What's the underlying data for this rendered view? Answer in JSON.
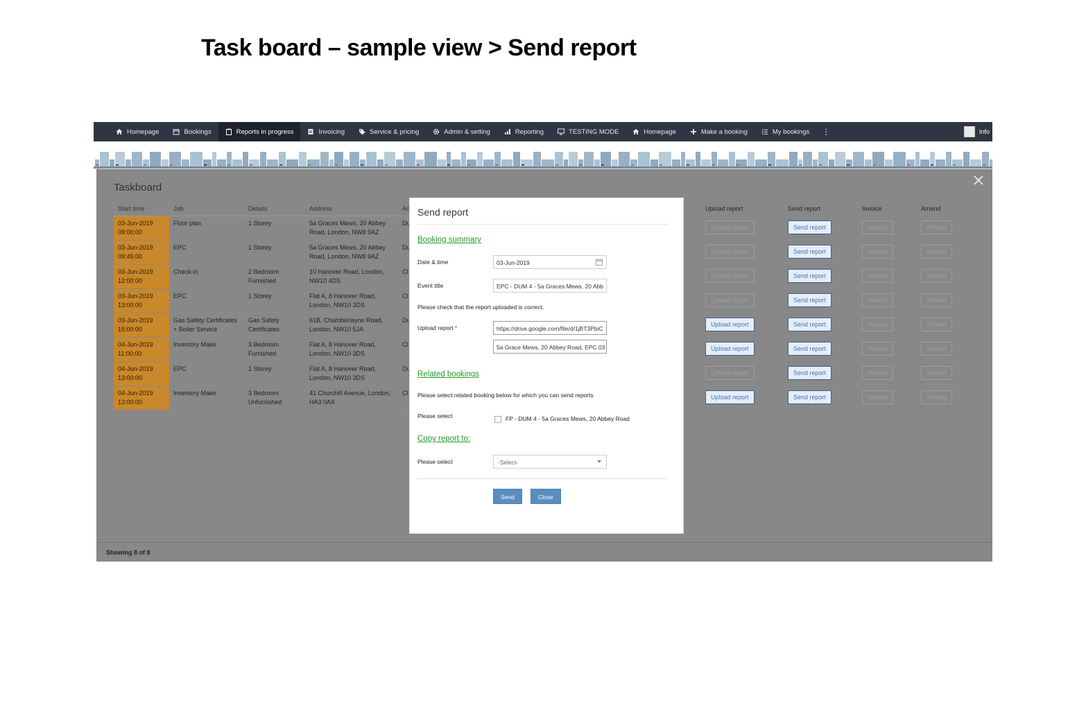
{
  "slide_title": "Task board – sample view > Send report",
  "nav": {
    "items": [
      {
        "label": "Homepage",
        "icon": "home-icon"
      },
      {
        "label": "Bookings",
        "icon": "calendar-icon"
      },
      {
        "label": "Reports in progress",
        "icon": "clipboard-icon"
      },
      {
        "label": "Invoicing",
        "icon": "invoice-icon"
      },
      {
        "label": "Service & pricing",
        "icon": "tag-icon"
      },
      {
        "label": "Admin & setting",
        "icon": "gear-icon"
      },
      {
        "label": "Reporting",
        "icon": "bar-chart-icon"
      },
      {
        "label": "TESTING MODE",
        "icon": "monitor-icon"
      },
      {
        "label": "Homepage",
        "icon": "home-icon"
      },
      {
        "label": "Make a booking",
        "icon": "plus-icon"
      },
      {
        "label": "My bookings",
        "icon": "list-icon"
      }
    ],
    "active_index": 2,
    "more": "⋮",
    "user": "Info"
  },
  "taskboard": {
    "title": "Taskboard",
    "columns": [
      "Start time",
      "Job",
      "Details",
      "Address",
      "Ac"
    ],
    "right_columns": [
      "Upload report",
      "Send report",
      "Invoice",
      "Amend"
    ],
    "rows": [
      {
        "start": [
          "03-Jun-2019",
          "09:00:00"
        ],
        "job": [
          "Floor plan"
        ],
        "details": [
          "1 Storey"
        ],
        "address": [
          "5a Graces Mews, 20 Abbey",
          "Road, London, NW8 9AZ"
        ],
        "ac": "Du",
        "upload": "Upload report",
        "upload_active": false,
        "send": "Send report",
        "invoice": "Invoice",
        "amend": "Amend"
      },
      {
        "start": [
          "03-Jun-2019",
          "09:45:00"
        ],
        "job": [
          "EPC"
        ],
        "details": [
          "1 Storey"
        ],
        "address": [
          "5a Graces Mews, 20 Abbey",
          "Road, London, NW8 9AZ"
        ],
        "ac": "Du",
        "upload": "Upload report",
        "upload_active": false,
        "send": "Send report",
        "invoice": "Invoice",
        "amend": "Amend"
      },
      {
        "start": [
          "03-Jun-2019",
          "12:00:00"
        ],
        "job": [
          "Check-in"
        ],
        "details": [
          "2 Bedroom",
          "Furnished"
        ],
        "address": [
          "10 Hanover Road, London,",
          "NW10 4DS"
        ],
        "ac": "Cl",
        "upload": "Upload report",
        "upload_active": false,
        "send": "Send report",
        "invoice": "Invoice",
        "amend": "Amend"
      },
      {
        "start": [
          "03-Jun-2019",
          "13:00:00"
        ],
        "job": [
          "EPC"
        ],
        "details": [
          "1 Storey"
        ],
        "address": [
          "Flat A, 8 Hanover Road,",
          "London, NW10 3DS"
        ],
        "ac": "Cl",
        "upload": "Upload report",
        "upload_active": false,
        "send": "Send report",
        "invoice": "Invoice",
        "amend": "Amend"
      },
      {
        "start": [
          "03-Jun-2019",
          "15:00:00"
        ],
        "job": [
          "Gas Safety Certificates",
          "+ Boiler Service"
        ],
        "details": [
          "Gas Safety",
          "Certificates"
        ],
        "address": [
          "61B, Chamberlayne Road,",
          "London, NW10 5JA"
        ],
        "ac": "Du",
        "upload": "Upload report",
        "upload_active": true,
        "send": "Send report",
        "invoice": "Invoice",
        "amend": "Amend"
      },
      {
        "start": [
          "04-Jun-2019",
          "11:00:00"
        ],
        "job": [
          "Inventory Make"
        ],
        "details": [
          "3 Bedroom",
          "Furnished"
        ],
        "address": [
          "Flat A, 8 Hanover Road,",
          "London, NW10 3DS"
        ],
        "ac": "Cl",
        "upload": "Upload report",
        "upload_active": true,
        "send": "Send report",
        "invoice": "Invoice",
        "amend": "Amend"
      },
      {
        "start": [
          "04-Jun-2019",
          "13:00:00"
        ],
        "job": [
          "EPC"
        ],
        "details": [
          "1 Storey"
        ],
        "address": [
          "Flat A, 8 Hanover Road,",
          "London, NW10 3DS"
        ],
        "ac": "Du",
        "upload": "Upload report",
        "upload_active": false,
        "send": "Send report",
        "invoice": "Invoice",
        "amend": "Amend"
      },
      {
        "start": [
          "04-Jun-2019",
          "13:00:00"
        ],
        "job": [
          "Inventory Make"
        ],
        "details": [
          "3 Bedroom",
          "Unfurnished"
        ],
        "address": [
          "41 Churchill Avenue, London,",
          "HA3 0AX"
        ],
        "ac": "Cl",
        "upload": "Upload report",
        "upload_active": true,
        "send": "Send report",
        "invoice": "Invoice",
        "amend": "Amend"
      }
    ],
    "footer": "Showing 8 of 8"
  },
  "modal": {
    "title": "Send report",
    "booking_summary": "Booking summary",
    "date_label": "Date & time",
    "date_value": "03-Jun-2019",
    "event_label": "Event title",
    "event_value": "EPC - DUM 4 - 5a Graces Mews, 20 Abb",
    "check_note": "Please check that the report uploaded is correct.",
    "upload_label": "Upload report",
    "upload_required": "*",
    "upload_url": "https://drive.google.com/file/d/1jBT3PbiC",
    "upload_name": "5a Grace Mews, 20 Abbey Road, EPC 03",
    "related_bookings": "Related bookings",
    "related_note": "Please select related booking below for which you can send reports",
    "please_select": "Please select",
    "related_option": "FP - DUM 4 - 5a Graces Mews, 20 Abbey Road",
    "copy_report": "Copy report to:",
    "copy_label": "Please select",
    "copy_placeholder": "-Select-",
    "send_btn": "Send",
    "close_btn": "Close"
  }
}
